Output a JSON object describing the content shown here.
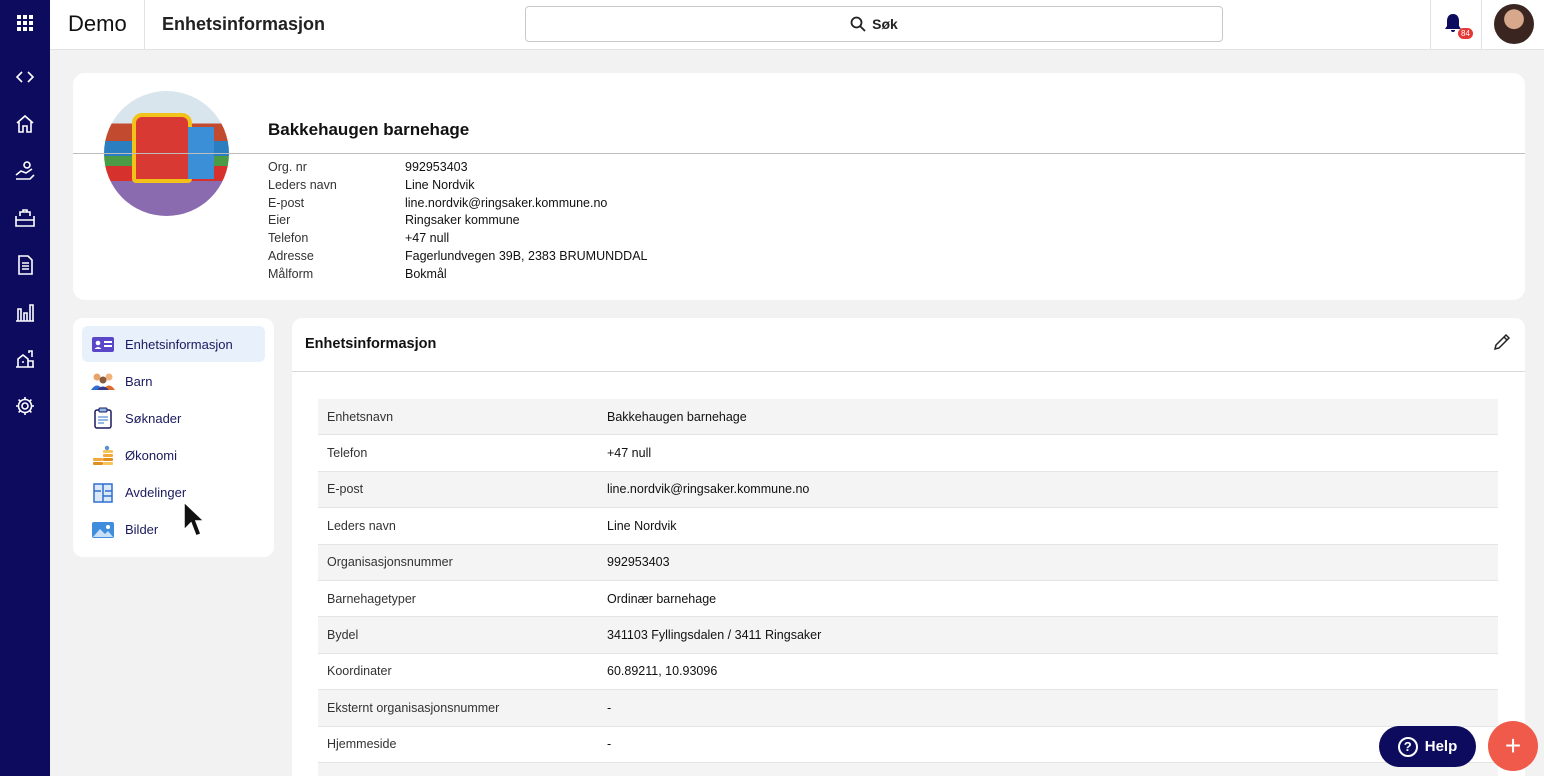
{
  "topbar": {
    "brand": "Demo",
    "title": "Enhetsinformasjon",
    "search_label": "Søk",
    "notification_count": "84"
  },
  "rail": {
    "icons": [
      "apps-grid-icon",
      "collapse-toggle-icon",
      "home-icon",
      "hands-icon",
      "crib-icon",
      "document-icon",
      "bar-chart-icon",
      "buildings-icon",
      "gear-icon"
    ]
  },
  "header": {
    "name": "Bakkehaugen barnehage",
    "rows": [
      {
        "label": "Org. nr",
        "value": "992953403"
      },
      {
        "label": "Leders navn",
        "value": "Line Nordvik"
      },
      {
        "label": "E-post",
        "value": "line.nordvik@ringsaker.kommune.no"
      },
      {
        "label": "Eier",
        "value": "Ringsaker kommune"
      },
      {
        "label": "Telefon",
        "value": "+47 null"
      },
      {
        "label": "Adresse",
        "value": "Fagerlundvegen 39B, 2383 BRUMUNDDAL"
      },
      {
        "label": "Målform",
        "value": "Bokmål"
      }
    ]
  },
  "menu": {
    "items": [
      {
        "label": "Enhetsinformasjon",
        "icon": "id-card-icon",
        "active": true
      },
      {
        "label": "Barn",
        "icon": "children-icon",
        "active": false
      },
      {
        "label": "Søknader",
        "icon": "clipboard-icon",
        "active": false
      },
      {
        "label": "Økonomi",
        "icon": "coins-icon",
        "active": false
      },
      {
        "label": "Avdelinger",
        "icon": "floorplan-icon",
        "active": false
      },
      {
        "label": "Bilder",
        "icon": "image-icon",
        "active": false
      }
    ]
  },
  "panel": {
    "title": "Enhetsinformasjon",
    "rows": [
      {
        "label": "Enhetsnavn",
        "value": "Bakkehaugen barnehage"
      },
      {
        "label": "Telefon",
        "value": "+47 null"
      },
      {
        "label": "E-post",
        "value": "line.nordvik@ringsaker.kommune.no"
      },
      {
        "label": "Leders navn",
        "value": "Line Nordvik"
      },
      {
        "label": "Organisasjonsnummer",
        "value": "992953403"
      },
      {
        "label": "Barnehagetyper",
        "value": "Ordinær barnehage"
      },
      {
        "label": "Bydel",
        "value": "341103 Fyllingsdalen / 3411 Ringsaker"
      },
      {
        "label": "Koordinater",
        "value": "60.89211, 10.93096"
      },
      {
        "label": "Eksternt organisasjonsnummer",
        "value": "-"
      },
      {
        "label": "Hjemmeside",
        "value": "-"
      }
    ]
  },
  "help": {
    "label": "Help"
  },
  "fab": {
    "label": "+"
  },
  "colors": {
    "rail": "#0d0b5e",
    "active_menu": "#e8f0fb",
    "fab": "#ef5a4b",
    "badge": "#e53935"
  }
}
